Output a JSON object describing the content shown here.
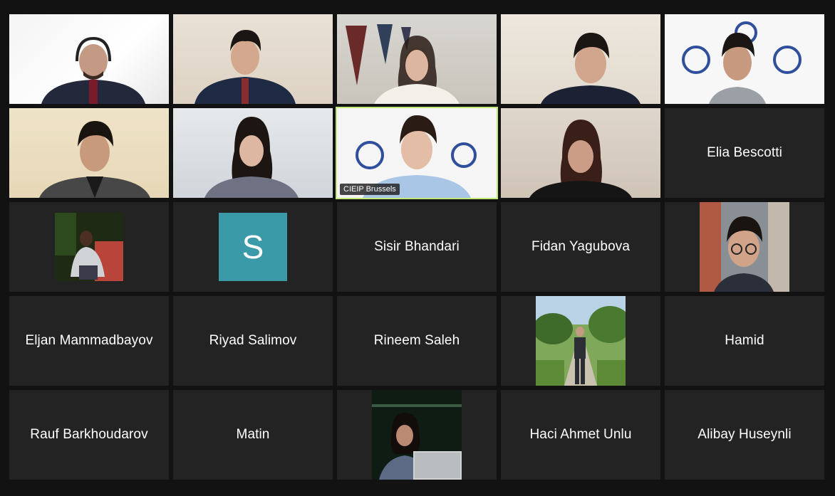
{
  "meeting": {
    "participants": [
      {
        "id": "p1",
        "type": "video"
      },
      {
        "id": "p2",
        "type": "video"
      },
      {
        "id": "p3",
        "type": "video"
      },
      {
        "id": "p4",
        "type": "video"
      },
      {
        "id": "p5",
        "type": "video"
      },
      {
        "id": "p6",
        "type": "video"
      },
      {
        "id": "p7",
        "type": "video"
      },
      {
        "id": "p8",
        "type": "video",
        "label": "CIEIP Brussels",
        "speaking": true
      },
      {
        "id": "p9",
        "type": "video"
      },
      {
        "id": "p10",
        "type": "name",
        "name": "Elia Bescotti"
      },
      {
        "id": "p11",
        "type": "photo"
      },
      {
        "id": "p12",
        "type": "avatar",
        "initial": "S",
        "color": "#3a9aa8"
      },
      {
        "id": "p13",
        "type": "name",
        "name": "Sisir Bhandari"
      },
      {
        "id": "p14",
        "type": "name",
        "name": "Fidan Yagubova"
      },
      {
        "id": "p15",
        "type": "photo"
      },
      {
        "id": "p16",
        "type": "name",
        "name": "Eljan Mammadbayov"
      },
      {
        "id": "p17",
        "type": "name",
        "name": "Riyad Salimov"
      },
      {
        "id": "p18",
        "type": "name",
        "name": "Rineem Saleh"
      },
      {
        "id": "p19",
        "type": "photo"
      },
      {
        "id": "p20",
        "type": "name",
        "name": "Hamid"
      },
      {
        "id": "p21",
        "type": "name",
        "name": "Rauf Barkhoudarov"
      },
      {
        "id": "p22",
        "type": "name",
        "name": "Matin"
      },
      {
        "id": "p23",
        "type": "photo"
      },
      {
        "id": "p24",
        "type": "name",
        "name": "Haci Ahmet Unlu"
      },
      {
        "id": "p25",
        "type": "name",
        "name": "Alibay Huseynli"
      }
    ]
  },
  "colors": {
    "background": "#121212",
    "tile": "#232323",
    "active_speaker": "#c4e77a",
    "avatar_s": "#3a9aa8"
  }
}
